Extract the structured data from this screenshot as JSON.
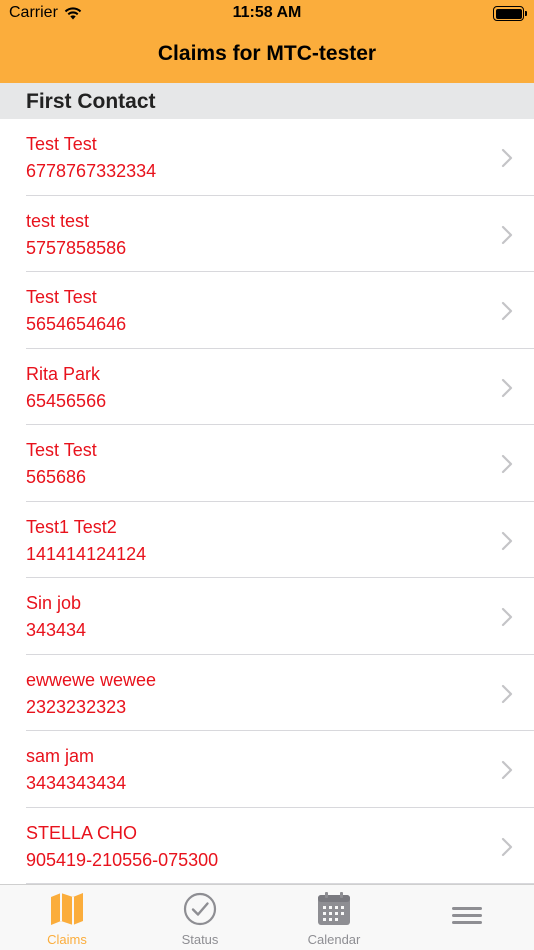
{
  "status_bar": {
    "carrier": "Carrier",
    "time": "11:58 AM"
  },
  "nav": {
    "title": "Claims for MTC-tester"
  },
  "section": {
    "title": "First Contact"
  },
  "claims": [
    {
      "name": "Test Test",
      "number": "6778767332334"
    },
    {
      "name": "test test",
      "number": "5757858586"
    },
    {
      "name": "Test Test",
      "number": "5654654646"
    },
    {
      "name": "Rita Park",
      "number": "65456566"
    },
    {
      "name": "Test Test",
      "number": "565686"
    },
    {
      "name": "Test1 Test2",
      "number": "141414124124"
    },
    {
      "name": "Sin job",
      "number": "343434"
    },
    {
      "name": "ewwewe wewee",
      "number": "2323232323"
    },
    {
      "name": "sam jam",
      "number": "3434343434"
    },
    {
      "name": "STELLA CHO",
      "number": "905419-210556-075300"
    }
  ],
  "tabs": [
    {
      "label": "Claims",
      "icon": "map-icon",
      "active": true
    },
    {
      "label": "Status",
      "icon": "checkmark-circle-icon",
      "active": false
    },
    {
      "label": "Calendar",
      "icon": "calendar-icon",
      "active": false
    },
    {
      "label": "",
      "icon": "menu-icon",
      "active": false
    }
  ],
  "colors": {
    "accent": "#fbad3c",
    "claim_text": "#e8121c",
    "section_bg": "#e6e7e8",
    "inactive_tab": "#8e8e93"
  }
}
